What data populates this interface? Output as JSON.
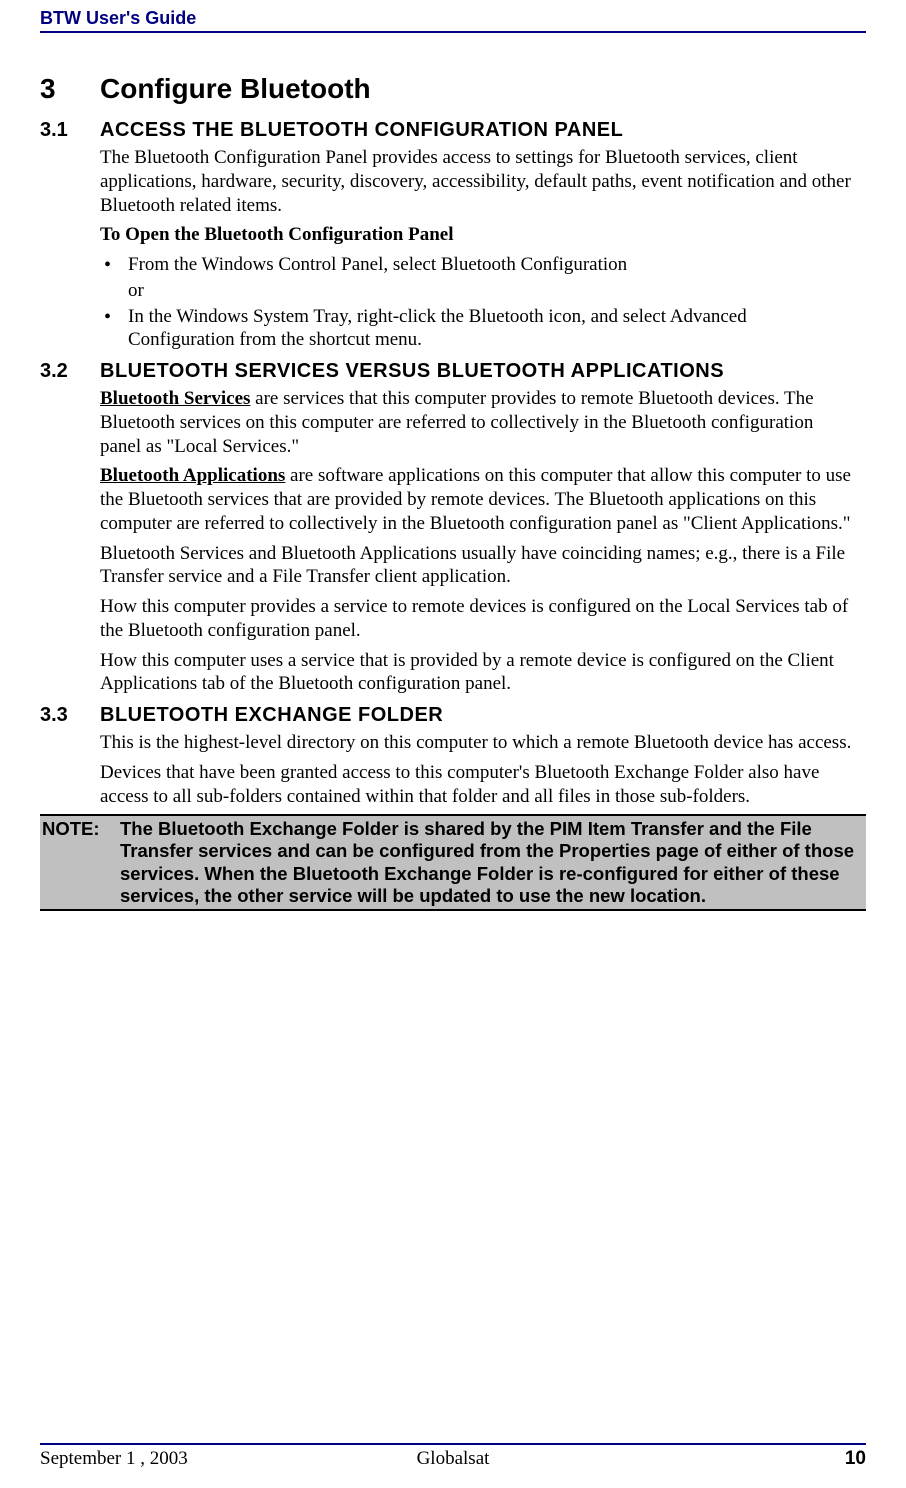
{
  "header": {
    "title": "BTW User's Guide"
  },
  "chapter": {
    "num": "3",
    "title": "Configure Bluetooth"
  },
  "sections": {
    "s1": {
      "num": "3.1",
      "title_html": "A<small>CCESS THE</small> B<small>LUETOOTH</small> C<small>ONFIGURATION</small> P<small>ANEL</small>",
      "title": "ACCESS THE BLUETOOTH CONFIGURATION PANEL",
      "intro": "The Bluetooth Configuration Panel provides access to settings for Bluetooth services, client applications, hardware, security, discovery, accessibility, default paths, event notification and other Bluetooth related items.",
      "open_label": "To Open the Bluetooth Configuration Panel",
      "bullets": [
        "From the Windows Control Panel, select Bluetooth Configuration",
        "In the Windows System Tray, right-click the Bluetooth icon, and select Advanced Configuration from the shortcut menu."
      ],
      "or": "or"
    },
    "s2": {
      "num": "3.2",
      "title": "BLUETOOTH SERVICES VERSUS BLUETOOTH APPLICATIONS",
      "para1_lead": "Bluetooth Services",
      "para1_rest": " are services that this computer provides to remote Bluetooth devices. The Bluetooth services on this computer are referred to collectively in the Bluetooth configuration panel as \"Local Services.\"",
      "para2_lead": "Bluetooth Applications",
      "para2_rest": " are software applications on this computer that allow this computer to use the Bluetooth services that are provided by remote devices. The Bluetooth applications on this computer are referred to collectively in the Bluetooth configuration panel as \"Client Applications.\"",
      "para3": "Bluetooth Services and Bluetooth Applications usually have coinciding names; e.g., there is a File Transfer service and a File Transfer client application.",
      "para4": "How this computer provides a service to remote devices is configured on the Local Services tab of the Bluetooth configuration panel.",
      "para5": "How this computer uses a service that is provided by a remote device is configured on the Client Applications tab of the Bluetooth configuration panel."
    },
    "s3": {
      "num": "3.3",
      "title": "BLUETOOTH EXCHANGE FOLDER",
      "para1": "This is the highest-level directory on this computer to which a remote Bluetooth device has access.",
      "para2": "Devices that have been granted access to this computer's Bluetooth Exchange Folder also have access to all sub-folders contained within that folder and all files in those sub-folders."
    }
  },
  "note": {
    "label": "NOTE:",
    "text": "The Bluetooth Exchange Folder is shared by the PIM Item Transfer and the File Transfer services and can be configured from the Properties page of either of those services. When the Bluetooth Exchange Folder is re-configured for either of these services, the other service will be updated to use the new location."
  },
  "footer": {
    "date": "September 1 , 2003",
    "company": "Globalsat",
    "page": "10"
  }
}
